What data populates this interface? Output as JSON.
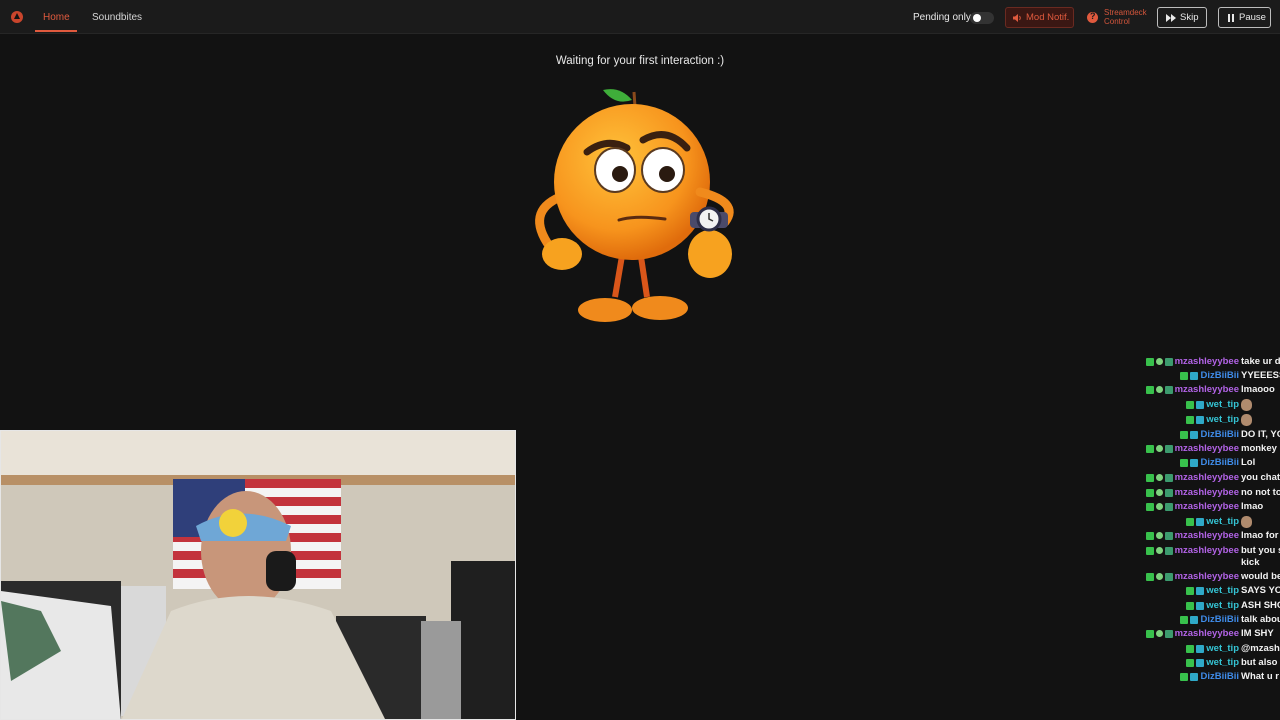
{
  "nav": {
    "tabs": [
      {
        "label": "Home",
        "active": true
      },
      {
        "label": "Soundbites",
        "active": false
      }
    ]
  },
  "controls": {
    "pending_only_label": "Pending only",
    "pending_only_enabled": false,
    "mod_notif_label": "Mod Notif.",
    "streamdeck_label": "Streamdeck Control",
    "skip_label": "Skip",
    "pause_label": "Pause"
  },
  "main": {
    "status_text": "Waiting for your first interaction :)"
  },
  "chat": {
    "messages": [
      {
        "user": "mzashleyybee",
        "text": "take ur d"
      },
      {
        "user": "DizBiiBii",
        "text": "YYEEESS"
      },
      {
        "user": "mzashleyybee",
        "text": "lmaooo"
      },
      {
        "user": "wet_tip",
        "text": ""
      },
      {
        "user": "wet_tip",
        "text": ""
      },
      {
        "user": "DizBiiBii",
        "text": "DO IT, YO"
      },
      {
        "user": "mzashleyybee",
        "text": "monkey"
      },
      {
        "user": "DizBiiBii",
        "text": "Lol"
      },
      {
        "user": "mzashleyybee",
        "text": "you chat"
      },
      {
        "user": "mzashleyybee",
        "text": "no not to"
      },
      {
        "user": "mzashleyybee",
        "text": "lmao"
      },
      {
        "user": "wet_tip",
        "text": ""
      },
      {
        "user": "mzashleyybee",
        "text": "lmao for"
      },
      {
        "user": "mzashleyybee",
        "text": "but you s"
      },
      {
        "user": "",
        "text": "kick"
      },
      {
        "user": "mzashleyybee",
        "text": "would be"
      },
      {
        "user": "wet_tip",
        "text": "SAYS YO"
      },
      {
        "user": "wet_tip",
        "text": "ASH SHO"
      },
      {
        "user": "DizBiiBii",
        "text": "talk abou"
      },
      {
        "user": "mzashleyybee",
        "text": "IM SHY"
      },
      {
        "user": "wet_tip",
        "text": "@mzash"
      },
      {
        "user": "wet_tip",
        "text": "but also"
      },
      {
        "user": "DizBiiBii",
        "text": "What u r"
      }
    ]
  },
  "colors": {
    "accent": "#e05a3e",
    "background": "#121212",
    "topbar": "#1b1b1b"
  },
  "icons": [
    "app-logo-icon",
    "speaker-icon",
    "streamdeck-icon",
    "skip-icon",
    "pause-icon"
  ]
}
